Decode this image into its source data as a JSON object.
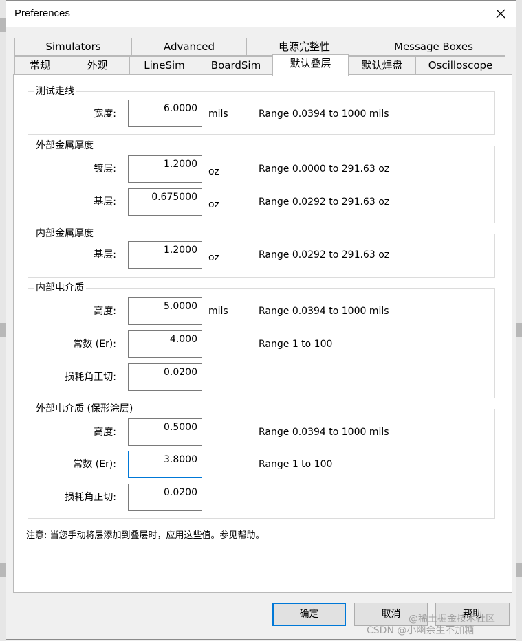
{
  "window": {
    "title": "Preferences"
  },
  "tabs": {
    "row1": [
      "Simulators",
      "Advanced",
      "电源完整性",
      "Message Boxes"
    ],
    "row2": [
      "常规",
      "外观",
      "LineSim",
      "BoardSim",
      "默认叠层",
      "默认焊盘",
      "Oscilloscope"
    ],
    "active": "默认叠层"
  },
  "groups": {
    "test_trace": {
      "title": "测试走线",
      "width": {
        "label": "宽度:",
        "value": "6.0000",
        "unit": "mils",
        "range": "Range 0.0394 to 1000 mils"
      }
    },
    "outer_metal": {
      "title": "外部金属厚度",
      "plating": {
        "label": "镀层:",
        "value": "1.2000",
        "unit": "oz",
        "range": "Range 0.0000 to 291.63 oz"
      },
      "base": {
        "label": "基层:",
        "value": "0.675000",
        "unit": "oz",
        "range": "Range 0.0292 to 291.63 oz"
      }
    },
    "inner_metal": {
      "title": "内部金属厚度",
      "base": {
        "label": "基层:",
        "value": "1.2000",
        "unit": "oz",
        "range": "Range 0.0292 to 291.63 oz"
      }
    },
    "inner_dielectric": {
      "title": "内部电介质",
      "height": {
        "label": "高度:",
        "value": "5.0000",
        "unit": "mils",
        "range": "Range 0.0394 to 1000 mils"
      },
      "constant": {
        "label": "常数 (Er):",
        "value": "4.000",
        "range": "Range 1 to 100"
      },
      "loss_tangent": {
        "label": "损耗角正切:",
        "value": "0.0200"
      }
    },
    "outer_dielectric": {
      "title": "外部电介质 (保形涂层)",
      "height": {
        "label": "高度:",
        "value": "0.5000",
        "range": "Range 0.0394 to 1000 mils"
      },
      "constant": {
        "label": "常数 (Er):",
        "value": "3.8000",
        "range": "Range 1 to 100"
      },
      "loss_tangent": {
        "label": "损耗角正切:",
        "value": "0.0200"
      }
    }
  },
  "note": "注意: 当您手动将层添加到叠层时，应用这些值。参见帮助。",
  "buttons": {
    "ok": "确定",
    "cancel": "取消",
    "help": "帮助"
  },
  "watermark": {
    "line1": "@稀土掘金技术社区",
    "line2": "CSDN @小幽余生不加糖"
  },
  "colors": {
    "accent": "#0078d7",
    "panel_bg": "#ffffff",
    "dialog_bg": "#f0f0f0"
  },
  "icons": {
    "close": "close-icon"
  }
}
